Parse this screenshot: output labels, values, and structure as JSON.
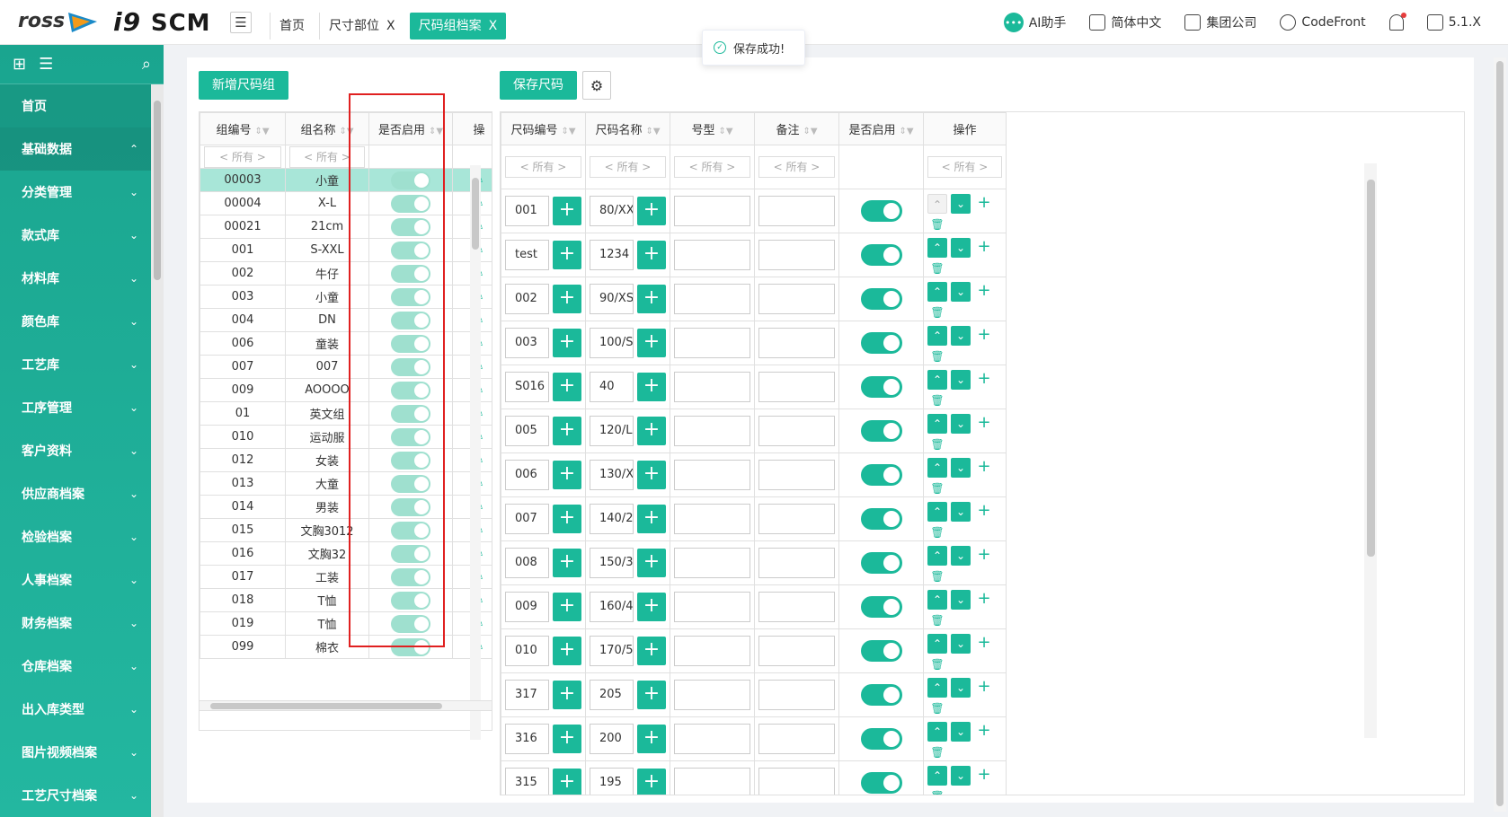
{
  "header": {
    "logo_text": "i9",
    "logo_scm": "SCM",
    "tabs": [
      {
        "label": "首页",
        "closable": false,
        "active": false
      },
      {
        "label": "尺寸部位",
        "closable": true,
        "active": false
      },
      {
        "label": "尺码组档案",
        "closable": true,
        "active": true
      }
    ],
    "close_glyph": "X",
    "right": {
      "ai_label": "AI助手",
      "lang_label": "简体中文",
      "company_label": "集团公司",
      "user_label": "CodeFront",
      "version_label": "5.1.X"
    }
  },
  "toast": {
    "message": "保存成功!"
  },
  "sidebar": {
    "items": [
      {
        "label": "首页"
      },
      {
        "label": "基础数据"
      },
      {
        "label": "分类管理"
      },
      {
        "label": "款式库"
      },
      {
        "label": "材料库"
      },
      {
        "label": "颜色库"
      },
      {
        "label": "工艺库"
      },
      {
        "label": "工序管理"
      },
      {
        "label": "客户资料"
      },
      {
        "label": "供应商档案"
      },
      {
        "label": "检验档案"
      },
      {
        "label": "人事档案"
      },
      {
        "label": "财务档案"
      },
      {
        "label": "仓库档案"
      },
      {
        "label": "出入库类型"
      },
      {
        "label": "图片视频档案"
      },
      {
        "label": "工艺尺寸档案"
      }
    ]
  },
  "toolbar": {
    "add_group_label": "新增尺码组",
    "save_size_label": "保存尺码"
  },
  "left_table": {
    "columns": [
      "组编号",
      "组名称",
      "是否启用",
      "操"
    ],
    "filter_placeholder": "< 所有 >",
    "rows": [
      {
        "code": "00003",
        "name": "小童"
      },
      {
        "code": "00004",
        "name": "X-L"
      },
      {
        "code": "00021",
        "name": "21cm"
      },
      {
        "code": "001",
        "name": "S-XXL"
      },
      {
        "code": "002",
        "name": "牛仔"
      },
      {
        "code": "003",
        "name": "小童"
      },
      {
        "code": "004",
        "name": "DN"
      },
      {
        "code": "006",
        "name": "童装"
      },
      {
        "code": "007",
        "name": "007"
      },
      {
        "code": "009",
        "name": "AOOOO"
      },
      {
        "code": "01",
        "name": "英文组"
      },
      {
        "code": "010",
        "name": "运动服"
      },
      {
        "code": "012",
        "name": "女装"
      },
      {
        "code": "013",
        "name": "大童"
      },
      {
        "code": "014",
        "name": "男装"
      },
      {
        "code": "015",
        "name": "文胸3012"
      },
      {
        "code": "016",
        "name": "文胸32"
      },
      {
        "code": "017",
        "name": "工装"
      },
      {
        "code": "018",
        "name": "T恤"
      },
      {
        "code": "019",
        "name": "T恤"
      },
      {
        "code": "099",
        "name": "棉衣"
      }
    ]
  },
  "right_table": {
    "columns": [
      "尺码编号",
      "尺码名称",
      "号型",
      "备注",
      "是否启用",
      "操作"
    ],
    "filter_placeholder": "< 所有 >",
    "rows": [
      {
        "code": "001",
        "name": "80/XX"
      },
      {
        "code": "test",
        "name": "1234"
      },
      {
        "code": "002",
        "name": "90/XS"
      },
      {
        "code": "003",
        "name": "100/S"
      },
      {
        "code": "S016",
        "name": "40"
      },
      {
        "code": "005",
        "name": "120/L"
      },
      {
        "code": "006",
        "name": "130/X"
      },
      {
        "code": "007",
        "name": "140/2"
      },
      {
        "code": "008",
        "name": "150/3"
      },
      {
        "code": "009",
        "name": "160/4"
      },
      {
        "code": "010",
        "name": "170/5"
      },
      {
        "code": "317",
        "name": "205"
      },
      {
        "code": "316",
        "name": "200"
      },
      {
        "code": "315",
        "name": "195"
      }
    ]
  },
  "colors": {
    "accent": "#1bb99a",
    "highlight_border": "#e02020"
  }
}
